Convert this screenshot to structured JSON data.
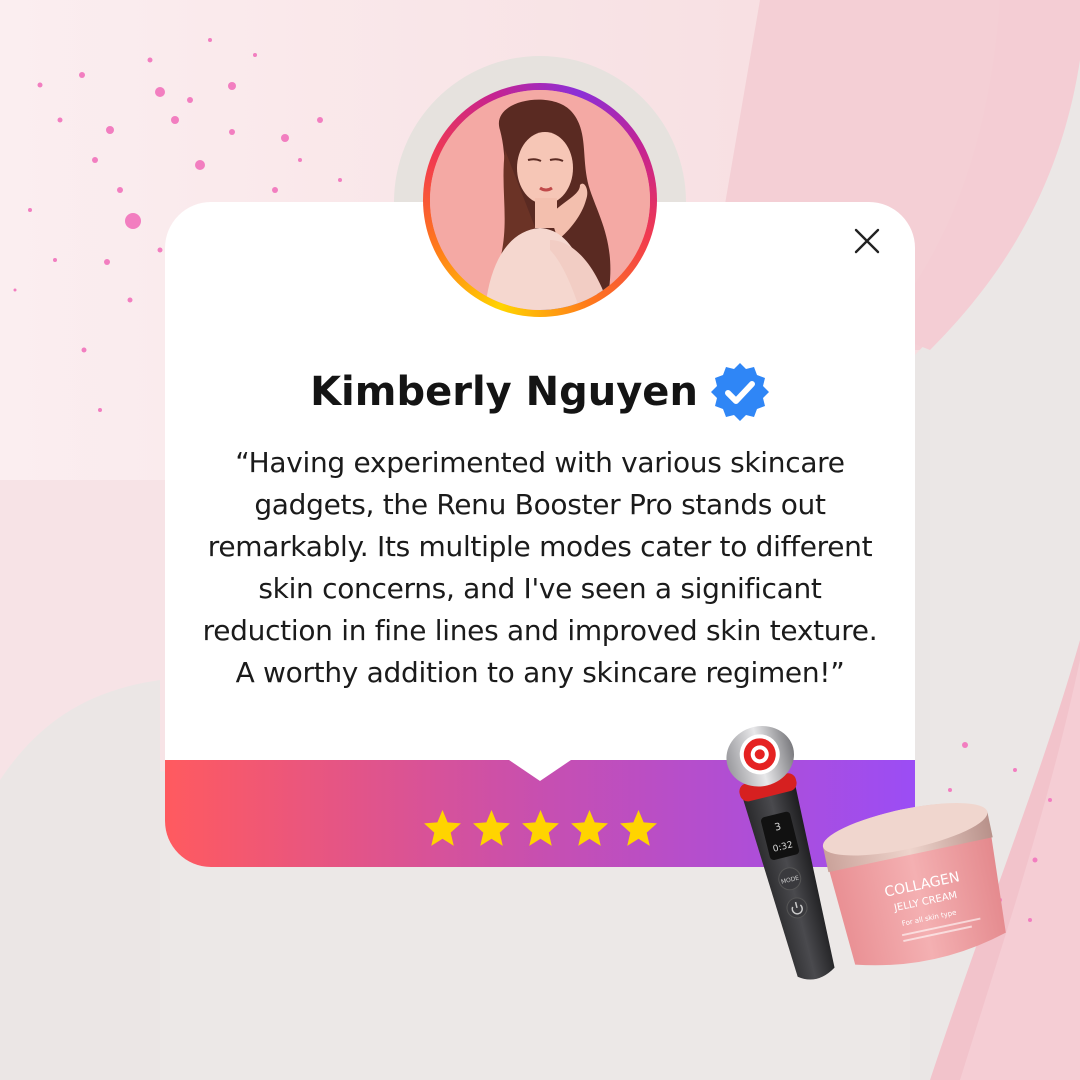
{
  "colors": {
    "card_gradient": [
      "#ff5a5f",
      "#c74fb0",
      "#9b4df5"
    ],
    "star": "#ffd400",
    "verified": "#2f86f6"
  },
  "reviewer": {
    "name": "Kimberly Nguyen",
    "verified_icon": "verified-badge-icon",
    "avatar_icon": "profile-photo"
  },
  "review": {
    "text": "“Having experimented with various skincare gadgets, the Renu Booster Pro stands out remarkably. Its multiple modes cater to different skin concerns, and I've seen a significant reduction in fine lines and improved skin texture. A worthy addition to any skincare regimen!”",
    "rating": 5,
    "rating_max": 5
  },
  "products": {
    "jar_title": "COLLAGEN",
    "jar_subtitle": "JELLY CREAM",
    "jar_tagline": "For all skin type",
    "device_mode_label": "MODE",
    "device_screen_value": "3",
    "device_timer": "0:32"
  },
  "close_icon": "close-icon"
}
